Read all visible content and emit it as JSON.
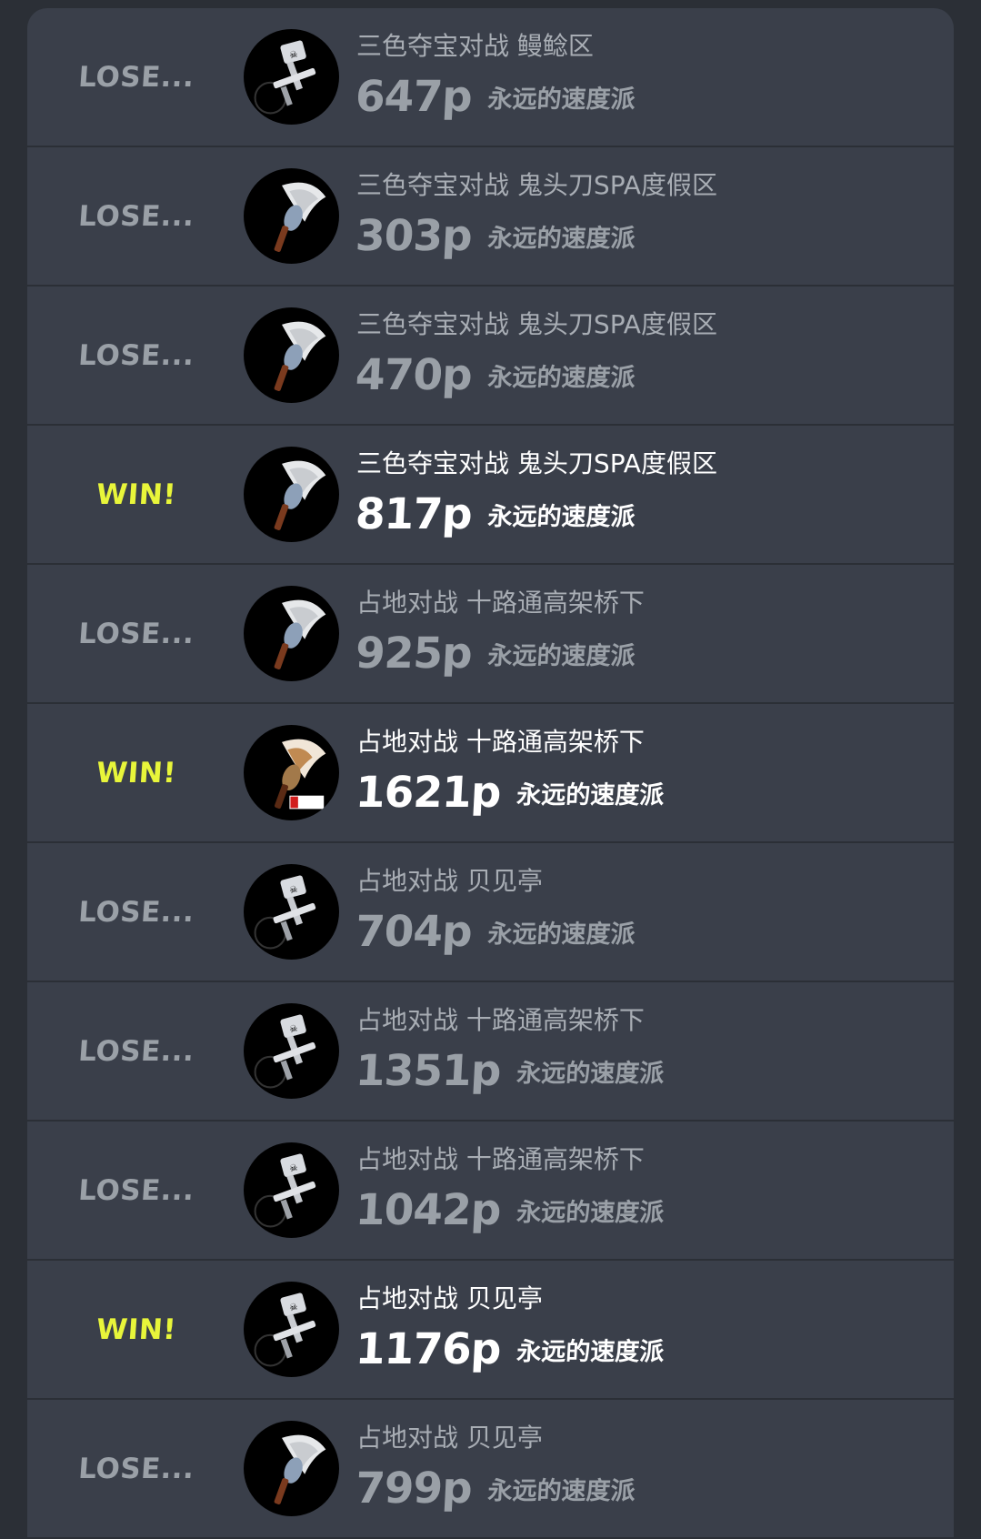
{
  "matches": [
    {
      "result": "LOSE...",
      "outcome": "lose",
      "mode": "三色夺宝对战",
      "stage": "鳗鲶区",
      "points": "647p",
      "team": "永远的速度派",
      "weapon_icon": "airbrush-icon"
    },
    {
      "result": "LOSE...",
      "outcome": "lose",
      "mode": "三色夺宝对战",
      "stage": "鬼头刀SPA度假区",
      "points": "303p",
      "team": "永远的速度派",
      "weapon_icon": "axe-icon"
    },
    {
      "result": "LOSE...",
      "outcome": "lose",
      "mode": "三色夺宝对战",
      "stage": "鬼头刀SPA度假区",
      "points": "470p",
      "team": "永远的速度派",
      "weapon_icon": "axe-icon"
    },
    {
      "result": "WIN!",
      "outcome": "win",
      "mode": "三色夺宝对战",
      "stage": "鬼头刀SPA度假区",
      "points": "817p",
      "team": "永远的速度派",
      "weapon_icon": "axe-icon"
    },
    {
      "result": "LOSE...",
      "outcome": "lose",
      "mode": "占地对战",
      "stage": "十路通高架桥下",
      "points": "925p",
      "team": "永远的速度派",
      "weapon_icon": "axe-icon"
    },
    {
      "result": "WIN!",
      "outcome": "win",
      "mode": "占地对战",
      "stage": "十路通高架桥下",
      "points": "1621p",
      "team": "永远的速度派",
      "weapon_icon": "golden-axe-icon"
    },
    {
      "result": "LOSE...",
      "outcome": "lose",
      "mode": "占地对战",
      "stage": "贝见亭",
      "points": "704p",
      "team": "永远的速度派",
      "weapon_icon": "airbrush-icon"
    },
    {
      "result": "LOSE...",
      "outcome": "lose",
      "mode": "占地对战",
      "stage": "十路通高架桥下",
      "points": "1351p",
      "team": "永远的速度派",
      "weapon_icon": "airbrush-icon"
    },
    {
      "result": "LOSE...",
      "outcome": "lose",
      "mode": "占地对战",
      "stage": "十路通高架桥下",
      "points": "1042p",
      "team": "永远的速度派",
      "weapon_icon": "airbrush-icon"
    },
    {
      "result": "WIN!",
      "outcome": "win",
      "mode": "占地对战",
      "stage": "贝见亭",
      "points": "1176p",
      "team": "永远的速度派",
      "weapon_icon": "airbrush-icon"
    },
    {
      "result": "LOSE...",
      "outcome": "lose",
      "mode": "占地对战",
      "stage": "贝见亭",
      "points": "799p",
      "team": "永远的速度派",
      "weapon_icon": "axe-icon"
    }
  ],
  "colors": {
    "background": "#2b2f36",
    "row": "#3a3f4a",
    "win": "#e8f53a",
    "lose": "#9aa0a7"
  }
}
